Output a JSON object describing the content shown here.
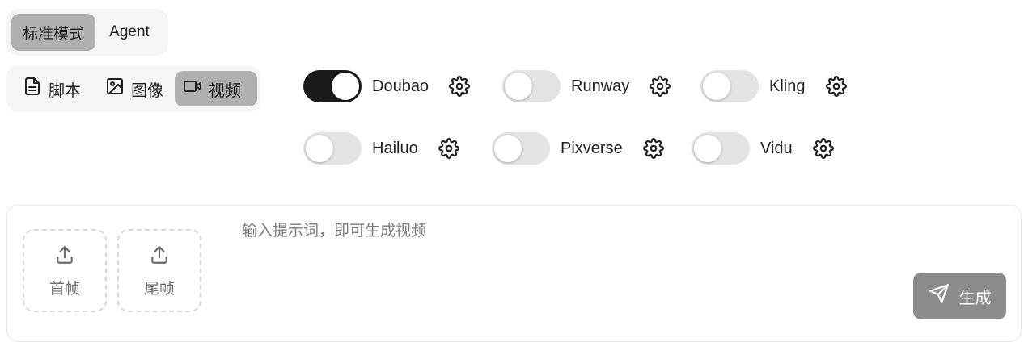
{
  "mode_tabs": [
    {
      "label": "标准模式",
      "active": true
    },
    {
      "label": "Agent",
      "active": false
    }
  ],
  "type_tabs": [
    {
      "label": "脚本",
      "icon": "document-icon",
      "active": false
    },
    {
      "label": "图像",
      "icon": "image-icon",
      "active": false
    },
    {
      "label": "视频",
      "icon": "video-camera-icon",
      "active": true
    }
  ],
  "models": [
    {
      "name": "Doubao",
      "enabled": true
    },
    {
      "name": "Runway",
      "enabled": false
    },
    {
      "name": "Kling",
      "enabled": false
    },
    {
      "name": "Hailuo",
      "enabled": false
    },
    {
      "name": "Pixverse",
      "enabled": false
    },
    {
      "name": "Vidu",
      "enabled": false
    }
  ],
  "upload": {
    "first_frame_label": "首帧",
    "last_frame_label": "尾帧"
  },
  "prompt": {
    "placeholder": "输入提示词，即可生成视频",
    "value": ""
  },
  "generate_label": "生成",
  "colors": {
    "active_tab": "#b0b0b0",
    "toggle_on": "#1a1a1a",
    "toggle_off": "#e3e3e3",
    "generate_button": "#8c8c8c"
  }
}
